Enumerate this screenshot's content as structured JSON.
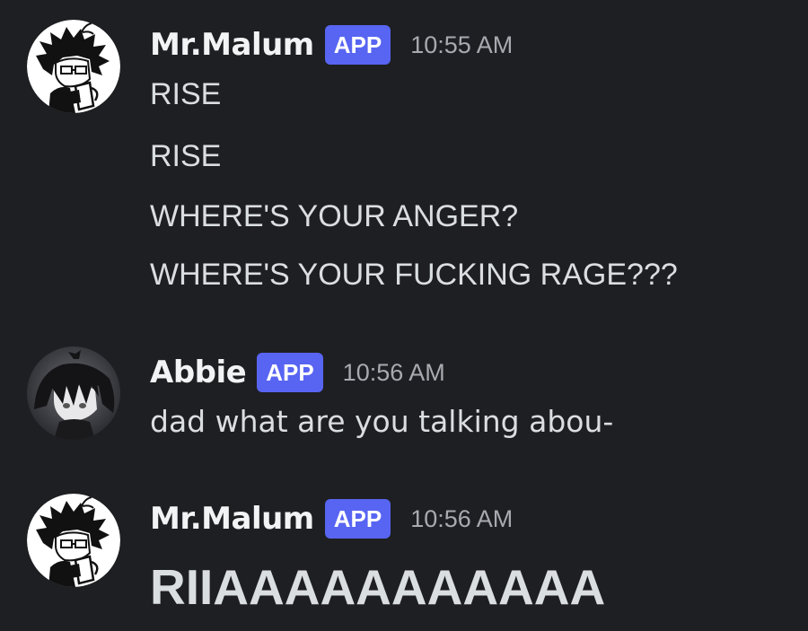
{
  "messages": [
    {
      "author": "Mr.Malum",
      "badge": "APP",
      "timestamp": "10:55 AM",
      "avatar_icon": "malum-avatar",
      "lines": [
        "RISE",
        "RISE",
        "WHERE'S YOUR ANGER?",
        "WHERE'S YOUR FUCKING RAGE???"
      ]
    },
    {
      "author": "Abbie",
      "badge": "APP",
      "timestamp": "10:56 AM",
      "avatar_icon": "abbie-avatar",
      "lines": [
        "dad what are you talking abou-"
      ]
    },
    {
      "author": "Mr.Malum",
      "badge": "APP",
      "timestamp": "10:56 AM",
      "avatar_icon": "malum-avatar",
      "lines": [
        "RIIAAAAAAAAAAA"
      ]
    }
  ],
  "colors": {
    "background": "#1e1f22",
    "badge": "#5865f2",
    "username": "#f2f3f5",
    "text": "#dbdee1",
    "timestamp": "#a7aab0"
  }
}
